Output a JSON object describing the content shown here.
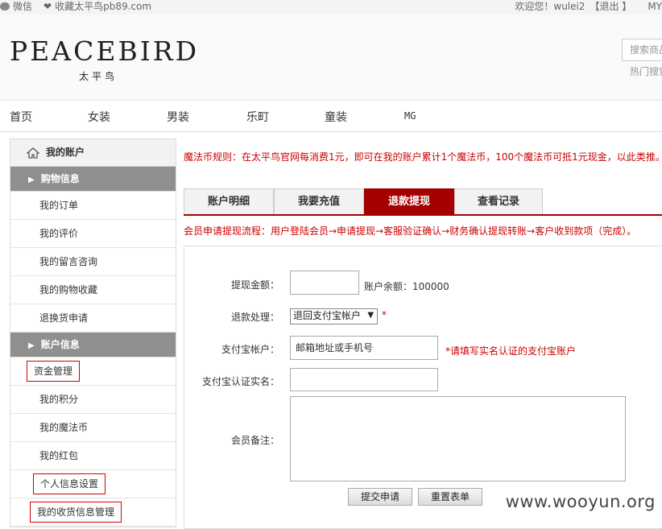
{
  "topbar": {
    "wechat": "微信",
    "favorite": "收藏太平鸟pb89.com",
    "welcome": "欢迎您！wulei2",
    "logout": "【退出 】",
    "my": "MY"
  },
  "header": {
    "logo_en": "PEACEBIRD",
    "logo_cn": "太平鸟",
    "search_placeholder": "搜索商品",
    "hot_label": "热门搜索"
  },
  "nav": [
    "首页",
    "女装",
    "男装",
    "乐町",
    "童装",
    "MG"
  ],
  "sidebar": {
    "title": "我的账户",
    "sections": [
      {
        "label": "购物信息",
        "items": [
          "我的订单",
          "我的评价",
          "我的留言咨询",
          "我的购物收藏",
          "退换货申请"
        ]
      },
      {
        "label": "账户信息",
        "items": [
          "资金管理",
          "我的积分",
          "我的魔法币",
          "我的红包",
          "个人信息设置",
          "我的收货信息管理"
        ]
      }
    ]
  },
  "main": {
    "rules": "魔法币规则：在太平鸟官网每消费1元，即可在我的账户累计1个魔法币，100个魔法币可抵1元现金，以此类推。",
    "tabs": [
      "账户明细",
      "我要充值",
      "退款提现",
      "查看记录"
    ],
    "active_tab": "退款提现",
    "flow": "会员申请提现流程：用户登陆会员→申请提现→客服验证确认→财务确认提现转账→客户收到款项（完成）。",
    "form": {
      "amount_label": "提现金额：",
      "balance": "账户余额：100000",
      "refund_label": "退款处理：",
      "refund_option": "退回支付宝帐户",
      "required_mark": "*",
      "alipay_label": "支付宝帐户：",
      "alipay_placeholder": "邮箱地址或手机号",
      "alipay_hint": "*请填写实名认证的支付宝账户",
      "realname_label": "支付宝认证实名：",
      "remark_label": "会员备注：",
      "submit": "提交申请",
      "reset": "重置表单"
    }
  },
  "watermark": "www.wooyun.org"
}
